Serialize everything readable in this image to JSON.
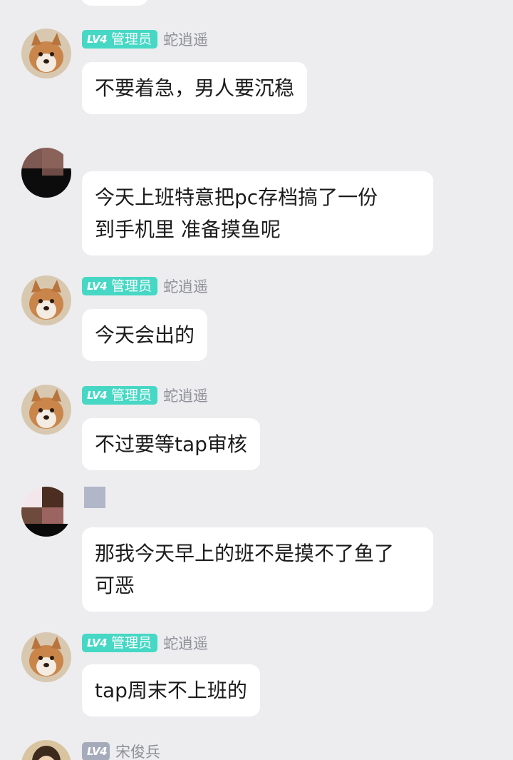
{
  "badges": {
    "level": "LV4",
    "admin_role": "管理员"
  },
  "messages": [
    {
      "user": "蛇逍遥",
      "text": "不要着急，男人要沉稳"
    },
    {
      "user": "",
      "text": "今天上班特意把pc存档搞了一份\n到手机里 准备摸鱼呢"
    },
    {
      "user": "蛇逍遥",
      "text": "今天会出的"
    },
    {
      "user": "蛇逍遥",
      "text": "不过要等tap审核"
    },
    {
      "user": "",
      "text": "那我今天早上的班不是摸不了鱼了\n可恶"
    },
    {
      "user": "蛇逍遥",
      "text": "tap周末不上班的"
    },
    {
      "user": "宋俊兵",
      "text": ""
    }
  ],
  "colors": {
    "background": "#ededf0",
    "bubble": "#ffffff",
    "admin_badge": "#46d8c4",
    "level_badge_gray": "#a6abbc",
    "username": "#8e9097"
  }
}
